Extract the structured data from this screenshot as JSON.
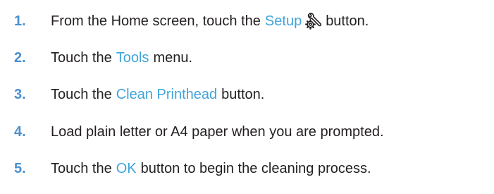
{
  "steps": [
    {
      "number": "1.",
      "before": "From the Home screen, touch the",
      "ui_label": "Setup",
      "icon": "setup-wrench-gear-icon",
      "after": "button."
    },
    {
      "number": "2.",
      "before": "Touch the",
      "ui_label": "Tools",
      "after": "menu."
    },
    {
      "number": "3.",
      "before": "Touch the",
      "ui_label": "Clean Printhead",
      "after": "button."
    },
    {
      "number": "4.",
      "text": "Load plain letter or A4 paper when you are prompted."
    },
    {
      "number": "5.",
      "before": "Touch the",
      "ui_label": "OK",
      "after": "button to begin the cleaning process."
    }
  ],
  "colors": {
    "number": "#4a8fd1",
    "ui_label": "#3fa4db",
    "text": "#231f20"
  }
}
